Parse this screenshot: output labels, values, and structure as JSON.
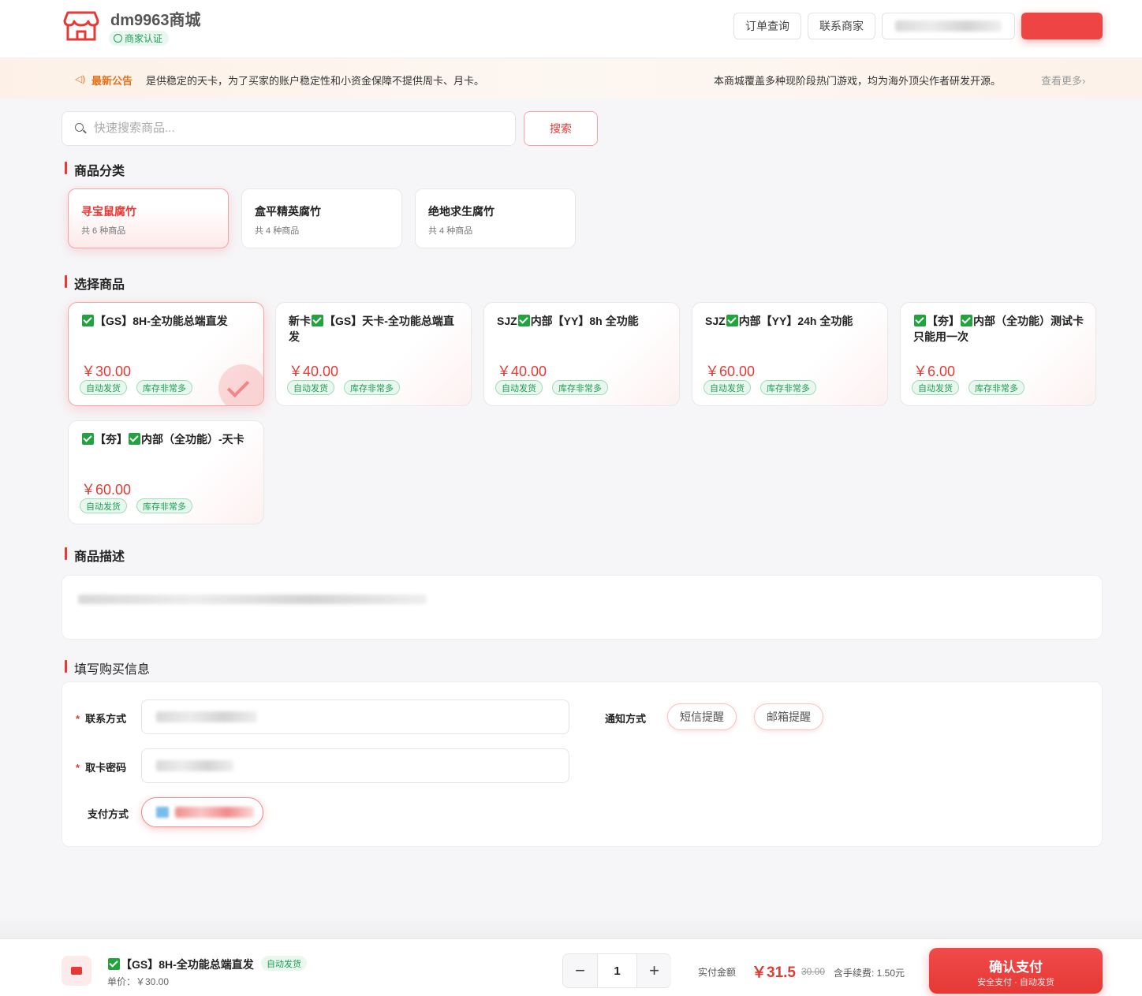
{
  "header": {
    "brand_name": "dm9963商城",
    "verify_badge": "商家认证",
    "order_query": "订单查询",
    "contact_merchant": "联系商家"
  },
  "notice": {
    "tag": "最新公告",
    "text": "是供稳定的天卡，为了买家的账户稳定性和小资金保障不提供周卡、月卡。",
    "right_text": "本商城覆盖多种现阶段热门游戏，均为海外顶尖作者研发开源。",
    "more": "查看更多›"
  },
  "search": {
    "placeholder": "快速搜索商品...",
    "button": "搜索"
  },
  "sections": {
    "category": "商品分类",
    "products": "选择商品",
    "description": "商品描述",
    "purchase": "填写购买信息"
  },
  "categories": [
    {
      "name": "寻宝鼠腐竹",
      "count": "共 6 种商品"
    },
    {
      "name": "盒平精英腐竹",
      "count": "共 4 种商品"
    },
    {
      "name": "绝地求生腐竹",
      "count": "共 4 种商品"
    }
  ],
  "products": [
    {
      "name_pre": "",
      "name_post": "【GS】8H-全功能总端直发",
      "price": "￥30.00"
    },
    {
      "name_pre": "新卡",
      "name_post": "【GS】天卡-全功能总端直发",
      "price": "￥40.00"
    },
    {
      "name_pre": "SJZ",
      "name_post": "内部【YY】8h 全功能",
      "price": "￥40.00"
    },
    {
      "name_pre": "SJZ",
      "name_post": "内部【YY】24h 全功能",
      "price": "￥60.00"
    },
    {
      "name_pre": "",
      "name_mid": "【夯】",
      "name_post": "内部（全功能）测试卡只能用一次",
      "price": "￥6.00"
    },
    {
      "name_pre": "",
      "name_mid": "【夯】",
      "name_post": "内部（全功能）-天卡",
      "price": "￥60.00"
    }
  ],
  "tags": {
    "auto": "自动发货",
    "stock": "库存非常多"
  },
  "form": {
    "contact_label": "联系方式",
    "card_pwd_label": "取卡密码",
    "pay_method_label": "支付方式",
    "notify_label": "通知方式",
    "sms_btn": "短信提醒",
    "email_btn": "邮箱提醒"
  },
  "bottom": {
    "product_name": "【GS】8H-全功能总端直发",
    "auto_tag": "自动发货",
    "unit_price": "单价：￥30.00",
    "quantity": "1",
    "minus": "−",
    "plus": "+",
    "pay_label": "实付金额",
    "pay_amount": "￥31.5",
    "orig_price": "30.00",
    "fee": "含手续费: 1.50元",
    "confirm": "确认支付",
    "confirm_sub": "安全支付 · 自动发货"
  },
  "colors": {
    "accent": "#e53935",
    "success": "#1e9c54"
  }
}
